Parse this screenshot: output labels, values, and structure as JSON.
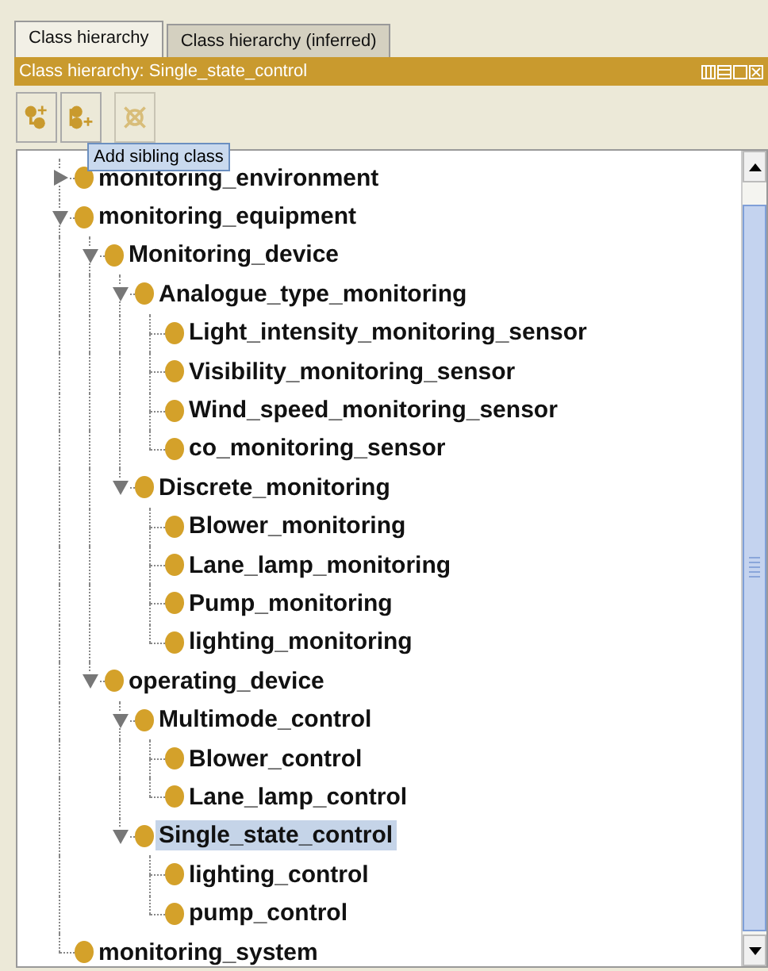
{
  "tabs": [
    {
      "label": "Class hierarchy",
      "selected": true
    },
    {
      "label": "Class hierarchy (inferred)",
      "selected": false
    }
  ],
  "header": {
    "title": "Class hierarchy: Single_state_control"
  },
  "toolbar": {
    "buttons": [
      {
        "kind": "add-subclass",
        "disabled": false
      },
      {
        "kind": "add-sibling",
        "disabled": false
      },
      {
        "kind": "delete",
        "disabled": true
      }
    ],
    "tooltip": "Add sibling class"
  },
  "tree": [
    {
      "label": "monitoring_environment",
      "expanded": false,
      "selected": false
    },
    {
      "label": "monitoring_equipment",
      "expanded": true,
      "selected": false,
      "children": [
        {
          "label": "Monitoring_device",
          "expanded": true,
          "selected": false,
          "children": [
            {
              "label": "Analogue_type_monitoring",
              "expanded": true,
              "selected": false,
              "children": [
                {
                  "label": "Light_intensity_monitoring_sensor",
                  "selected": false
                },
                {
                  "label": "Visibility_monitoring_sensor",
                  "selected": false
                },
                {
                  "label": "Wind_speed_monitoring_sensor",
                  "selected": false
                },
                {
                  "label": "co_monitoring_sensor",
                  "selected": false
                }
              ]
            },
            {
              "label": "Discrete_monitoring",
              "expanded": true,
              "selected": false,
              "children": [
                {
                  "label": "Blower_monitoring",
                  "selected": false
                },
                {
                  "label": "Lane_lamp_monitoring",
                  "selected": false
                },
                {
                  "label": "Pump_monitoring",
                  "selected": false
                },
                {
                  "label": "lighting_monitoring",
                  "selected": false
                }
              ]
            }
          ]
        },
        {
          "label": "operating_device",
          "expanded": true,
          "selected": false,
          "children": [
            {
              "label": "Multimode_control",
              "expanded": true,
              "selected": false,
              "children": [
                {
                  "label": "Blower_control",
                  "selected": false
                },
                {
                  "label": "Lane_lamp_control",
                  "selected": false
                }
              ]
            },
            {
              "label": "Single_state_control",
              "expanded": true,
              "selected": true,
              "children": [
                {
                  "label": "lighting_control",
                  "selected": false
                },
                {
                  "label": "pump_control",
                  "selected": false
                }
              ]
            }
          ]
        }
      ]
    },
    {
      "label": "monitoring_system",
      "selected": false
    }
  ]
}
